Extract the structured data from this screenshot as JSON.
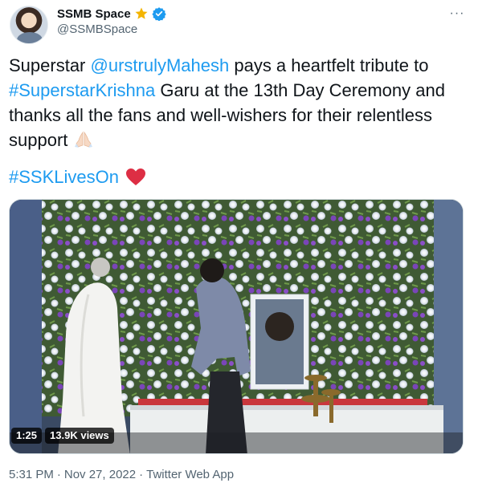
{
  "author": {
    "display_name": "SSMB Space",
    "handle": "@SSMBSpace",
    "avatar_icon": "profile-photo-avatar",
    "badges": [
      "star-icon",
      "verified-icon"
    ],
    "colors": {
      "star": "#f4b400",
      "verified": "#1d9bf0"
    }
  },
  "menu": {
    "more_label": "···"
  },
  "tweet": {
    "text_1": "Superstar ",
    "mention": "@urstrulyMahesh",
    "text_2": " pays a heartfelt tribute to ",
    "hashtag_1": "#SuperstarKrishna",
    "text_3": " Garu at the 13th Day Ceremony and thanks all the fans and well-wishers for their relentless support",
    "emoji_1": "folded-hands-icon",
    "hashtag_2": "#SSKLivesOn",
    "emoji_2": "red-heart-icon",
    "link_color": "#1d9bf0"
  },
  "media": {
    "type": "video",
    "duration": "1:25",
    "views": "13.9K views"
  },
  "meta": {
    "time": "5:31 PM",
    "separator_1": "·",
    "date": "Nov 27, 2022",
    "separator_2": "·",
    "source": "Twitter Web App"
  }
}
